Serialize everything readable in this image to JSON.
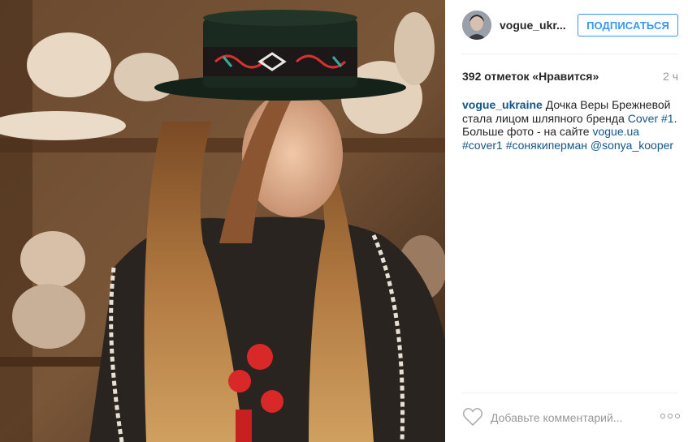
{
  "post": {
    "username": "vogue_ukr...",
    "follow_label": "ПОДПИСАТЬСЯ",
    "likes_text": "392 отметок «Нравится»",
    "time_ago": "2 ч",
    "caption": {
      "user": "vogue_ukraine",
      "text_1": "Дочка Веры Брежневой стала лицом шляпного бренда",
      "tag_cover": "Cover",
      "hash_1": "#1",
      "text_2": ". Больше фото - на сайте",
      "site_link": "vogue.ua",
      "hash_cover1": "#cover1",
      "hash_sonya": "#сонякиперман",
      "mention": "@sonya_kooper"
    },
    "comment_placeholder": "Добавьте комментарий..."
  },
  "icons": {
    "heart": "heart-outline-icon",
    "more": "ellipsis-icon"
  },
  "colors": {
    "accent": "#3897f0",
    "link": "#125688",
    "muted": "#999999"
  }
}
